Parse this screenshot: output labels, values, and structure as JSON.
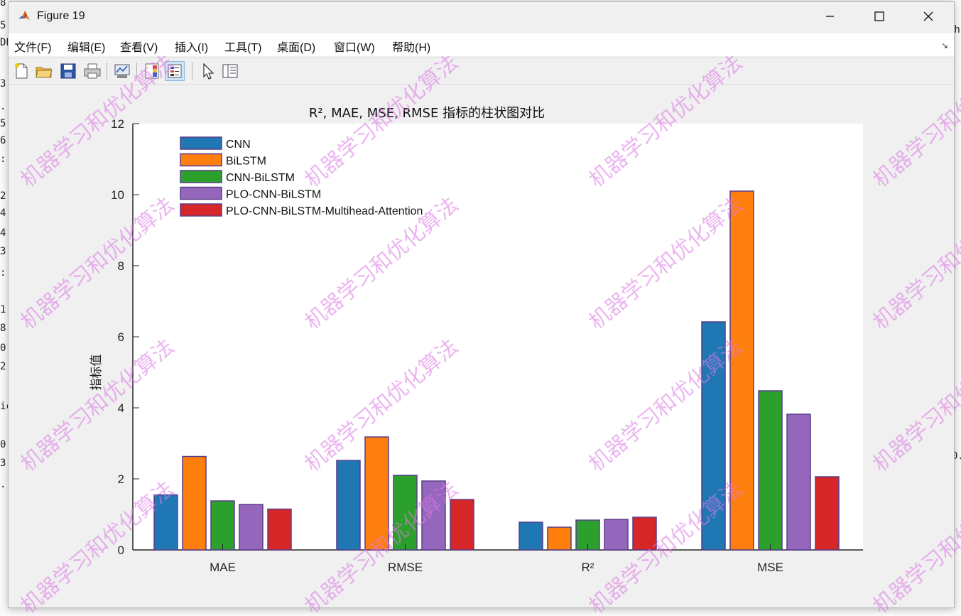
{
  "window": {
    "title": "Figure 19",
    "controls": [
      "minimize",
      "maximize",
      "close"
    ]
  },
  "menu": [
    {
      "label": "文件(F)"
    },
    {
      "label": "编辑(E)"
    },
    {
      "label": "查看(V)"
    },
    {
      "label": "插入(I)"
    },
    {
      "label": "工具(T)"
    },
    {
      "label": "桌面(D)"
    },
    {
      "label": "窗口(W)"
    },
    {
      "label": "帮助(H)"
    }
  ],
  "toolbar": [
    {
      "icon": "new-figure-icon"
    },
    {
      "icon": "open-file-icon"
    },
    {
      "icon": "save-icon"
    },
    {
      "icon": "print-icon"
    },
    {
      "icon": "link-plot-icon"
    },
    {
      "icon": "insert-colorbar-icon"
    },
    {
      "icon": "insert-legend-icon",
      "active": true
    },
    {
      "icon": "pointer-icon"
    },
    {
      "icon": "property-editor-icon"
    }
  ],
  "watermark_text": "机器学习和优化算法",
  "background_fragments": [
    "8",
    "5",
    "DE",
    "3",
    ".",
    "5",
    "6",
    ":",
    "2",
    "4",
    "4",
    "3",
    ":",
    "1",
    "8",
    "0",
    "2",
    "ic",
    "0",
    "3",
    ".",
    "ih",
    "0."
  ],
  "chart_data": {
    "type": "bar",
    "title": "R², MAE, MSE, RMSE 指标的柱状图对比",
    "xlabel": "",
    "ylabel": "指标值",
    "ylim": [
      0,
      12
    ],
    "yticks": [
      0,
      2,
      4,
      6,
      8,
      10,
      12
    ],
    "categories": [
      "MAE",
      "RMSE",
      "R²",
      "MSE"
    ],
    "legend_position": "top-left",
    "grid": false,
    "series": [
      {
        "name": "CNN",
        "color": "#1f77b4",
        "values": [
          1.55,
          2.52,
          0.78,
          6.42
        ]
      },
      {
        "name": "BiLSTM",
        "color": "#ff7f0e",
        "values": [
          2.63,
          3.18,
          0.64,
          10.1
        ]
      },
      {
        "name": "CNN-BiLSTM",
        "color": "#2ca02c",
        "values": [
          1.38,
          2.1,
          0.84,
          4.48
        ]
      },
      {
        "name": "PLO-CNN-BiLSTM",
        "color": "#9467bd",
        "values": [
          1.28,
          1.94,
          0.86,
          3.82
        ]
      },
      {
        "name": "PLO-CNN-BiLSTM-Multihead-Attention",
        "color": "#d62728",
        "values": [
          1.15,
          1.42,
          0.92,
          2.06
        ]
      }
    ]
  }
}
